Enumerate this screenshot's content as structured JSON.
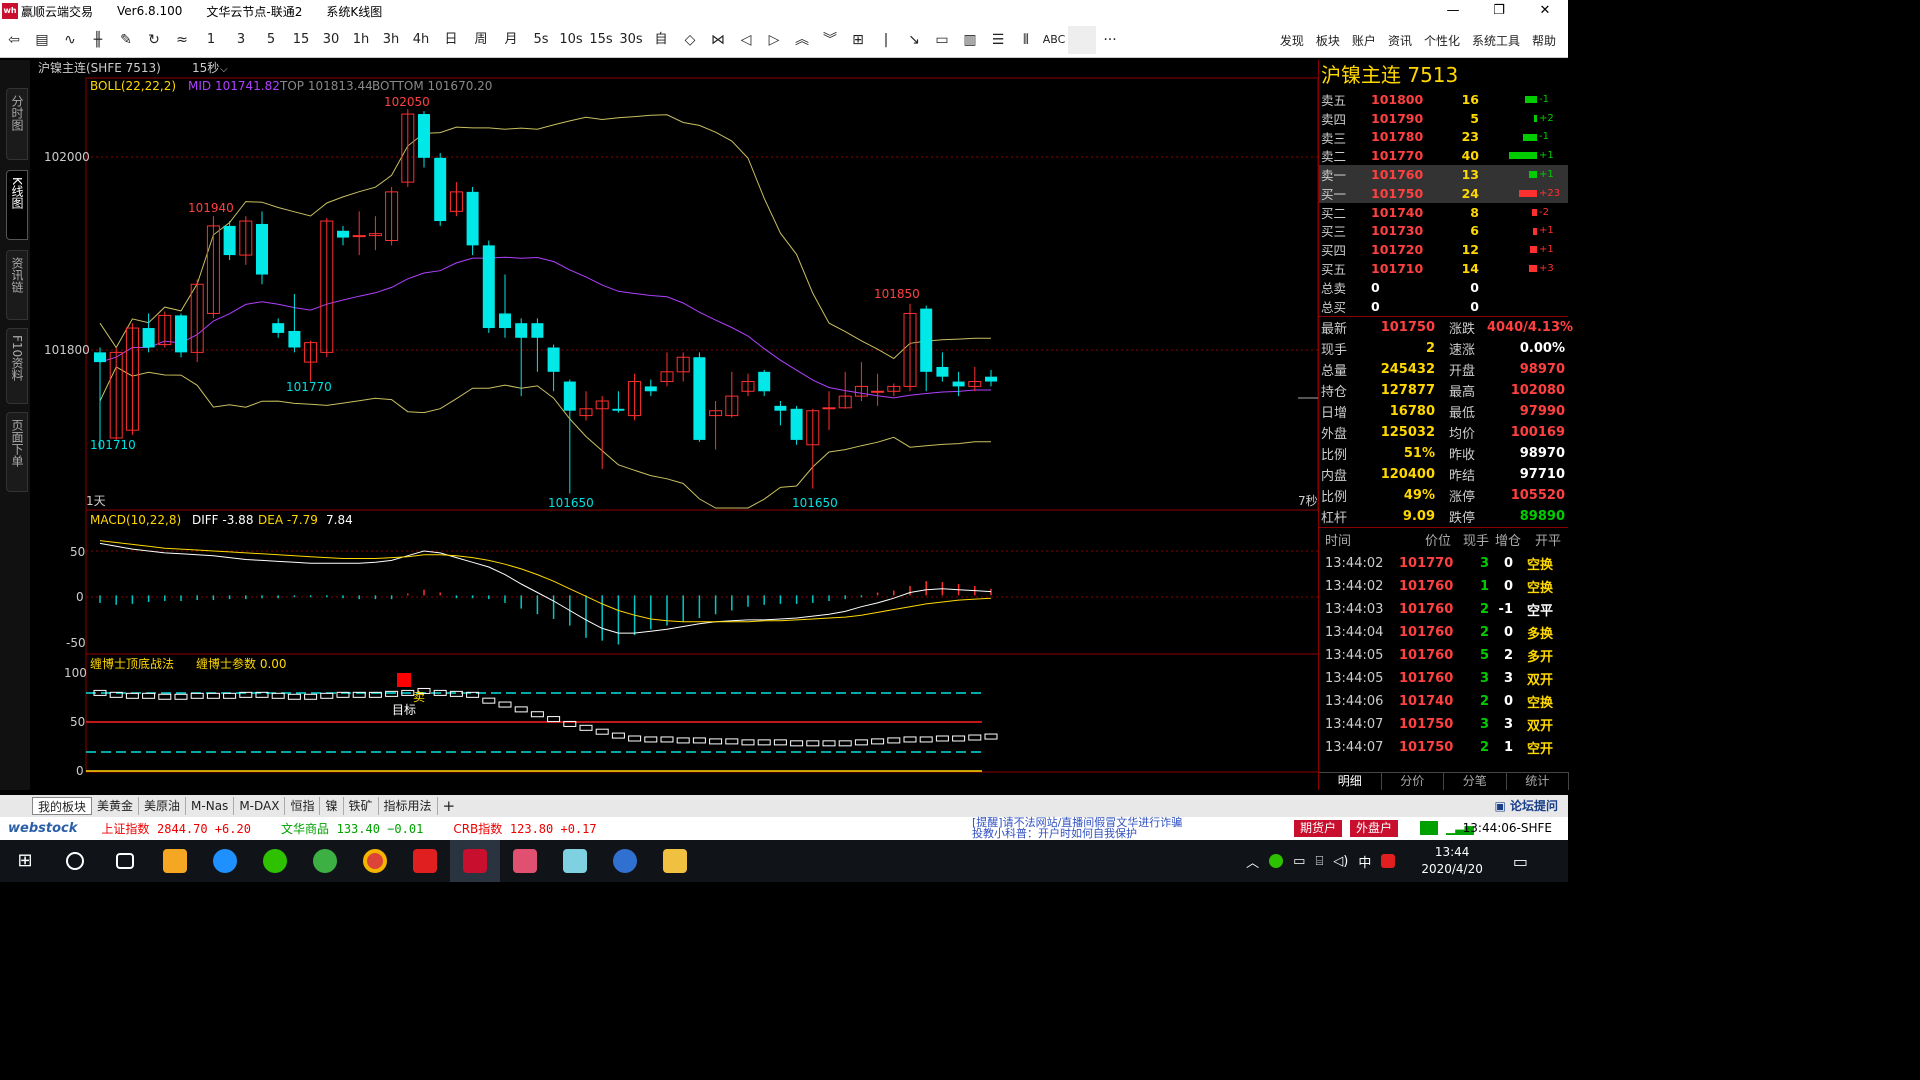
{
  "window": {
    "app_name": "赢顺云端交易",
    "version": "Ver6.8.100",
    "node": "文华云节点-联通2",
    "view": "系统K线图",
    "minimize": "—",
    "maximize": "❐",
    "close": "✕"
  },
  "toolbar": {
    "items": [
      "1",
      "3",
      "5",
      "15",
      "30",
      "1h",
      "3h",
      "4h",
      "日",
      "周",
      "月",
      "5s",
      "10s",
      "15s",
      "30s",
      "自"
    ],
    "right_menu": [
      "发现",
      "板块",
      "账户",
      "资讯",
      "个性化",
      "系统工具",
      "帮助"
    ],
    "abc_label": "ABC",
    "more_label": "···"
  },
  "left_tabs": [
    "分时图",
    "K线图",
    "资讯链",
    "F10资料",
    "页面下单"
  ],
  "chart_header": {
    "instrument": "沪镍主连(SHFE 7513)",
    "period": "15秒",
    "period_caret": "⌵"
  },
  "boll": {
    "name": "BOLL(22,22,2)",
    "mid": "MID 101741.82",
    "top": "TOP 101813.44",
    "bottom": "BOTTOM 101670.20",
    "price_labels": [
      "102000",
      "101800"
    ],
    "annotations": [
      "102050",
      "101940",
      "101770",
      "101710",
      "101650",
      "101650",
      "101850"
    ],
    "left_tag": "1天",
    "right_tag": "7秒"
  },
  "macd": {
    "name": "MACD(10,22,8)",
    "diff": "DIFF -3.88",
    "dea": "DEA -7.79",
    "macd": "7.84",
    "axis": [
      "50",
      "0",
      "-50"
    ]
  },
  "indicator3": {
    "name": "缠博士顶底战法",
    "param": "缠博士参数 0.00",
    "axis": [
      "100",
      "50",
      "0"
    ],
    "tag_target": "目标",
    "tag_sell": "卖"
  },
  "chart_data": [
    {
      "type": "candlestick",
      "title": "BOLL(22,22,2)",
      "ylim": [
        101640,
        102080
      ],
      "bars": [
        {
          "o": 101800,
          "c": 101790,
          "h": 101805,
          "l": 101700
        },
        {
          "o": 101712,
          "c": 101800,
          "h": 101805,
          "l": 101710
        },
        {
          "o": 101720,
          "c": 101825,
          "h": 101830,
          "l": 101715
        },
        {
          "o": 101825,
          "c": 101805,
          "h": 101840,
          "l": 101800
        },
        {
          "o": 101808,
          "c": 101838,
          "h": 101842,
          "l": 101805
        },
        {
          "o": 101838,
          "c": 101800,
          "h": 101840,
          "l": 101795
        },
        {
          "o": 101800,
          "c": 101870,
          "h": 101875,
          "l": 101790
        },
        {
          "o": 101840,
          "c": 101930,
          "h": 101940,
          "l": 101835
        },
        {
          "o": 101930,
          "c": 101900,
          "h": 101935,
          "l": 101895
        },
        {
          "o": 101900,
          "c": 101935,
          "h": 101940,
          "l": 101890
        },
        {
          "o": 101932,
          "c": 101880,
          "h": 101945,
          "l": 101870
        },
        {
          "o": 101830,
          "c": 101820,
          "h": 101835,
          "l": 101815
        },
        {
          "o": 101822,
          "c": 101805,
          "h": 101860,
          "l": 101800
        },
        {
          "o": 101790,
          "c": 101810,
          "h": 101812,
          "l": 101770
        },
        {
          "o": 101800,
          "c": 101935,
          "h": 101938,
          "l": 101795
        },
        {
          "o": 101925,
          "c": 101918,
          "h": 101930,
          "l": 101910
        },
        {
          "o": 101920,
          "c": 101920,
          "h": 101945,
          "l": 101900
        },
        {
          "o": 101920,
          "c": 101922,
          "h": 101940,
          "l": 101905
        },
        {
          "o": 101915,
          "c": 101965,
          "h": 101970,
          "l": 101910
        },
        {
          "o": 101975,
          "c": 102045,
          "h": 102050,
          "l": 101970
        },
        {
          "o": 102045,
          "c": 102000,
          "h": 102048,
          "l": 101990
        },
        {
          "o": 102000,
          "c": 101935,
          "h": 102005,
          "l": 101930
        },
        {
          "o": 101945,
          "c": 101965,
          "h": 101975,
          "l": 101940
        },
        {
          "o": 101965,
          "c": 101910,
          "h": 101970,
          "l": 101900
        },
        {
          "o": 101910,
          "c": 101825,
          "h": 101915,
          "l": 101820
        },
        {
          "o": 101840,
          "c": 101825,
          "h": 101880,
          "l": 101815
        },
        {
          "o": 101830,
          "c": 101815,
          "h": 101835,
          "l": 101755
        },
        {
          "o": 101830,
          "c": 101815,
          "h": 101835,
          "l": 101780
        },
        {
          "o": 101805,
          "c": 101780,
          "h": 101808,
          "l": 101760
        },
        {
          "o": 101770,
          "c": 101740,
          "h": 101772,
          "l": 101655
        },
        {
          "o": 101735,
          "c": 101742,
          "h": 101760,
          "l": 101730
        },
        {
          "o": 101742,
          "c": 101750,
          "h": 101755,
          "l": 101680
        },
        {
          "o": 101742,
          "c": 101740,
          "h": 101760,
          "l": 101738
        },
        {
          "o": 101735,
          "c": 101770,
          "h": 101778,
          "l": 101730
        },
        {
          "o": 101765,
          "c": 101760,
          "h": 101772,
          "l": 101755
        },
        {
          "o": 101770,
          "c": 101780,
          "h": 101800,
          "l": 101765
        },
        {
          "o": 101780,
          "c": 101795,
          "h": 101800,
          "l": 101770
        },
        {
          "o": 101795,
          "c": 101710,
          "h": 101800,
          "l": 101708
        },
        {
          "o": 101735,
          "c": 101740,
          "h": 101750,
          "l": 101700
        },
        {
          "o": 101735,
          "c": 101755,
          "h": 101780,
          "l": 101733
        },
        {
          "o": 101760,
          "c": 101770,
          "h": 101778,
          "l": 101755
        },
        {
          "o": 101780,
          "c": 101760,
          "h": 101782,
          "l": 101755
        },
        {
          "o": 101745,
          "c": 101740,
          "h": 101750,
          "l": 101725
        },
        {
          "o": 101742,
          "c": 101710,
          "h": 101745,
          "l": 101705
        },
        {
          "o": 101705,
          "c": 101740,
          "h": 101742,
          "l": 101660
        },
        {
          "o": 101742,
          "c": 101743,
          "h": 101760,
          "l": 101720
        },
        {
          "o": 101743,
          "c": 101755,
          "h": 101780,
          "l": 101742
        },
        {
          "o": 101755,
          "c": 101765,
          "h": 101790,
          "l": 101750
        },
        {
          "o": 101760,
          "c": 101760,
          "h": 101778,
          "l": 101745
        },
        {
          "o": 101760,
          "c": 101765,
          "h": 101768,
          "l": 101755
        },
        {
          "o": 101765,
          "c": 101840,
          "h": 101850,
          "l": 101760
        },
        {
          "o": 101845,
          "c": 101780,
          "h": 101848,
          "l": 101760
        },
        {
          "o": 101785,
          "c": 101775,
          "h": 101800,
          "l": 101770
        },
        {
          "o": 101770,
          "c": 101765,
          "h": 101780,
          "l": 101755
        },
        {
          "o": 101765,
          "c": 101770,
          "h": 101785,
          "l": 101760
        },
        {
          "o": 101775,
          "c": 101770,
          "h": 101782,
          "l": 101765
        }
      ]
    },
    {
      "type": "bar",
      "title": "MACD(10,22,8)",
      "ylim": [
        -60,
        65
      ],
      "histogram": [
        -8,
        -10,
        -9,
        -7,
        -6,
        -6,
        -5,
        -5,
        -4,
        -4,
        -3,
        -3,
        -2,
        -2,
        -2,
        -3,
        -4,
        -4,
        -4,
        2,
        6,
        3,
        -3,
        -3,
        -4,
        -8,
        -14,
        -20,
        -25,
        -32,
        -45,
        -48,
        -52,
        -42,
        -36,
        -32,
        -28,
        -24,
        -20,
        -16,
        -12,
        -10,
        -9,
        -9,
        -8,
        -6,
        -4,
        -2,
        3,
        5,
        10,
        15,
        14,
        12,
        10,
        7
      ],
      "diff": [
        55,
        52,
        49,
        47,
        45,
        44,
        43,
        42,
        40,
        38,
        37,
        36,
        35,
        34,
        34,
        34,
        34,
        35,
        37,
        42,
        47,
        45,
        40,
        35,
        30,
        22,
        12,
        3,
        -6,
        -16,
        -26,
        -35,
        -40,
        -40,
        -38,
        -36,
        -33,
        -30,
        -28,
        -27,
        -26,
        -26,
        -25,
        -24,
        -22,
        -20,
        -17,
        -12,
        -8,
        -3,
        3,
        6,
        7,
        6,
        5,
        4
      ],
      "dea": [
        58,
        56,
        54,
        52,
        50,
        49,
        48,
        47,
        46,
        45,
        44,
        43,
        42,
        41,
        40,
        39,
        39,
        39,
        40,
        41,
        43,
        43,
        42,
        40,
        37,
        33,
        28,
        22,
        15,
        7,
        -1,
        -9,
        -16,
        -21,
        -25,
        -27,
        -28,
        -28,
        -28,
        -28,
        -28,
        -27,
        -27,
        -26,
        -25,
        -24,
        -23,
        -21,
        -18,
        -15,
        -12,
        -9,
        -7,
        -5,
        -4,
        -3
      ]
    },
    {
      "type": "line",
      "title": "缠博士顶底战法",
      "ylim": [
        0,
        100
      ],
      "steps": [
        80,
        78,
        77,
        77,
        76,
        76,
        77,
        77,
        77,
        78,
        78,
        77,
        76,
        76,
        77,
        78,
        78,
        78,
        79,
        80,
        82,
        80,
        79,
        78,
        72,
        68,
        63,
        58,
        53,
        48,
        44,
        40,
        36,
        33,
        32,
        32,
        31,
        31,
        30,
        30,
        29,
        29,
        29,
        28,
        28,
        28,
        28,
        29,
        30,
        31,
        32,
        32,
        33,
        33,
        34,
        35
      ]
    }
  ],
  "right_panel": {
    "title": "沪镍主连  7513",
    "orderbook": [
      {
        "label": "卖五",
        "price": "101800",
        "vol": "16",
        "chg": "-1",
        "bar": 12,
        "color": "#00cc00"
      },
      {
        "label": "卖四",
        "price": "101790",
        "vol": "5",
        "chg": "+2",
        "bar": 3,
        "color": "#00cc00"
      },
      {
        "label": "卖三",
        "price": "101780",
        "vol": "23",
        "chg": "-1",
        "bar": 14,
        "color": "#00cc00"
      },
      {
        "label": "卖二",
        "price": "101770",
        "vol": "40",
        "chg": "+1",
        "bar": 28,
        "color": "#00cc00"
      },
      {
        "label": "卖一",
        "price": "101760",
        "vol": "13",
        "chg": "+1",
        "bar": 8,
        "color": "#00cc00"
      },
      {
        "label": "买一",
        "price": "101750",
        "vol": "24",
        "chg": "+23",
        "bar": 18,
        "color": "#ff3030"
      },
      {
        "label": "买二",
        "price": "101740",
        "vol": "8",
        "chg": "-2",
        "bar": 5,
        "color": "#ff3030"
      },
      {
        "label": "买三",
        "price": "101730",
        "vol": "6",
        "chg": "+1",
        "bar": 4,
        "color": "#ff3030"
      },
      {
        "label": "买四",
        "price": "101720",
        "vol": "12",
        "chg": "+1",
        "bar": 7,
        "color": "#ff3030"
      },
      {
        "label": "买五",
        "price": "101710",
        "vol": "14",
        "chg": "+3",
        "bar": 8,
        "color": "#ff3030"
      },
      {
        "label": "总卖",
        "price": "0",
        "vol": "0",
        "chg": "",
        "bar": 0,
        "color": "#000"
      },
      {
        "label": "总买",
        "price": "0",
        "vol": "0",
        "chg": "",
        "bar": 0,
        "color": "#000"
      }
    ],
    "quote": [
      {
        "l": "最新",
        "v": "101750",
        "vc": "#ff4040",
        "l2": "涨跌",
        "v2": "4040/4.13%",
        "v2c": "#ff4040"
      },
      {
        "l": "现手",
        "v": "2",
        "vc": "#ffd800",
        "l2": "速涨",
        "v2": "0.00%",
        "v2c": "#ffffff"
      },
      {
        "l": "总量",
        "v": "245432",
        "vc": "#ffd800",
        "l2": "开盘",
        "v2": "98970",
        "v2c": "#ff4040"
      },
      {
        "l": "持仓",
        "v": "127877",
        "vc": "#ffd800",
        "l2": "最高",
        "v2": "102080",
        "v2c": "#ff4040"
      },
      {
        "l": "日增",
        "v": "16780",
        "vc": "#ffd800",
        "l2": "最低",
        "v2": "97990",
        "v2c": "#ff4040"
      },
      {
        "l": "外盘",
        "v": "125032",
        "vc": "#ffd800",
        "l2": "均价",
        "v2": "100169",
        "v2c": "#ff4040"
      },
      {
        "l": "比例",
        "v": "51%",
        "vc": "#ffd800",
        "l2": "昨收",
        "v2": "98970",
        "v2c": "#ffffff"
      },
      {
        "l": "内盘",
        "v": "120400",
        "vc": "#ffd800",
        "l2": "昨结",
        "v2": "97710",
        "v2c": "#ffffff"
      },
      {
        "l": "比例",
        "v": "49%",
        "vc": "#ffd800",
        "l2": "涨停",
        "v2": "105520",
        "v2c": "#ff4040"
      },
      {
        "l": "杠杆",
        "v": "9.09",
        "vc": "#ffd800",
        "l2": "跌停",
        "v2": "89890",
        "v2c": "#00cc00"
      }
    ],
    "trades_header": [
      "时间",
      "价位",
      "现手",
      "增仓",
      "开平"
    ],
    "trades": [
      {
        "t": "13:44:02",
        "p": "101770",
        "q": "3",
        "oi": "0",
        "ty": "空换",
        "tc": "#ffd800"
      },
      {
        "t": "13:44:02",
        "p": "101760",
        "q": "1",
        "oi": "0",
        "ty": "空换",
        "tc": "#ffd800"
      },
      {
        "t": "13:44:03",
        "p": "101760",
        "q": "2",
        "oi": "-1",
        "ty": "空平",
        "tc": "#ffffff"
      },
      {
        "t": "13:44:04",
        "p": "101760",
        "q": "2",
        "oi": "0",
        "ty": "多换",
        "tc": "#ffd800"
      },
      {
        "t": "13:44:05",
        "p": "101760",
        "q": "5",
        "oi": "2",
        "ty": "多开",
        "tc": "#ffd800"
      },
      {
        "t": "13:44:05",
        "p": "101760",
        "q": "3",
        "oi": "3",
        "ty": "双开",
        "tc": "#ffd800"
      },
      {
        "t": "13:44:06",
        "p": "101740",
        "q": "2",
        "oi": "0",
        "ty": "空换",
        "tc": "#ffd800"
      },
      {
        "t": "13:44:07",
        "p": "101750",
        "q": "3",
        "oi": "3",
        "ty": "双开",
        "tc": "#ffd800"
      },
      {
        "t": "13:44:07",
        "p": "101750",
        "q": "2",
        "oi": "1",
        "ty": "空开",
        "tc": "#ffd800"
      }
    ],
    "tabs": [
      "明细",
      "分价",
      "分笔",
      "统计"
    ]
  },
  "bottom_tabs": [
    "我的板块",
    "美黄金",
    "美原油",
    "M-Nas",
    "M-DAX",
    "恒指",
    "镍",
    "铁矿",
    "指标用法"
  ],
  "bottom_add": "+",
  "forum_label": "论坛提问",
  "status": {
    "brand": "webstock",
    "idx1_name": "上证指数",
    "idx1_val": "2844.70 +6.20",
    "idx2_name": "文华商品",
    "idx2_val": "133.40 −0.01",
    "idx3_name": "CRB指数",
    "idx3_val": "123.80 +0.17",
    "notice1": "[提醒]请不法网站/直播间假冒文华进行诈骗",
    "notice2": "投教小科普：开户时如何自我保护",
    "futures_btn": "期货户",
    "fx_btn": "外盘户",
    "clock": "13:44:06-SHFE"
  },
  "taskbar": {
    "time": "13:44",
    "date": "2020/4/20",
    "ime": "中"
  }
}
